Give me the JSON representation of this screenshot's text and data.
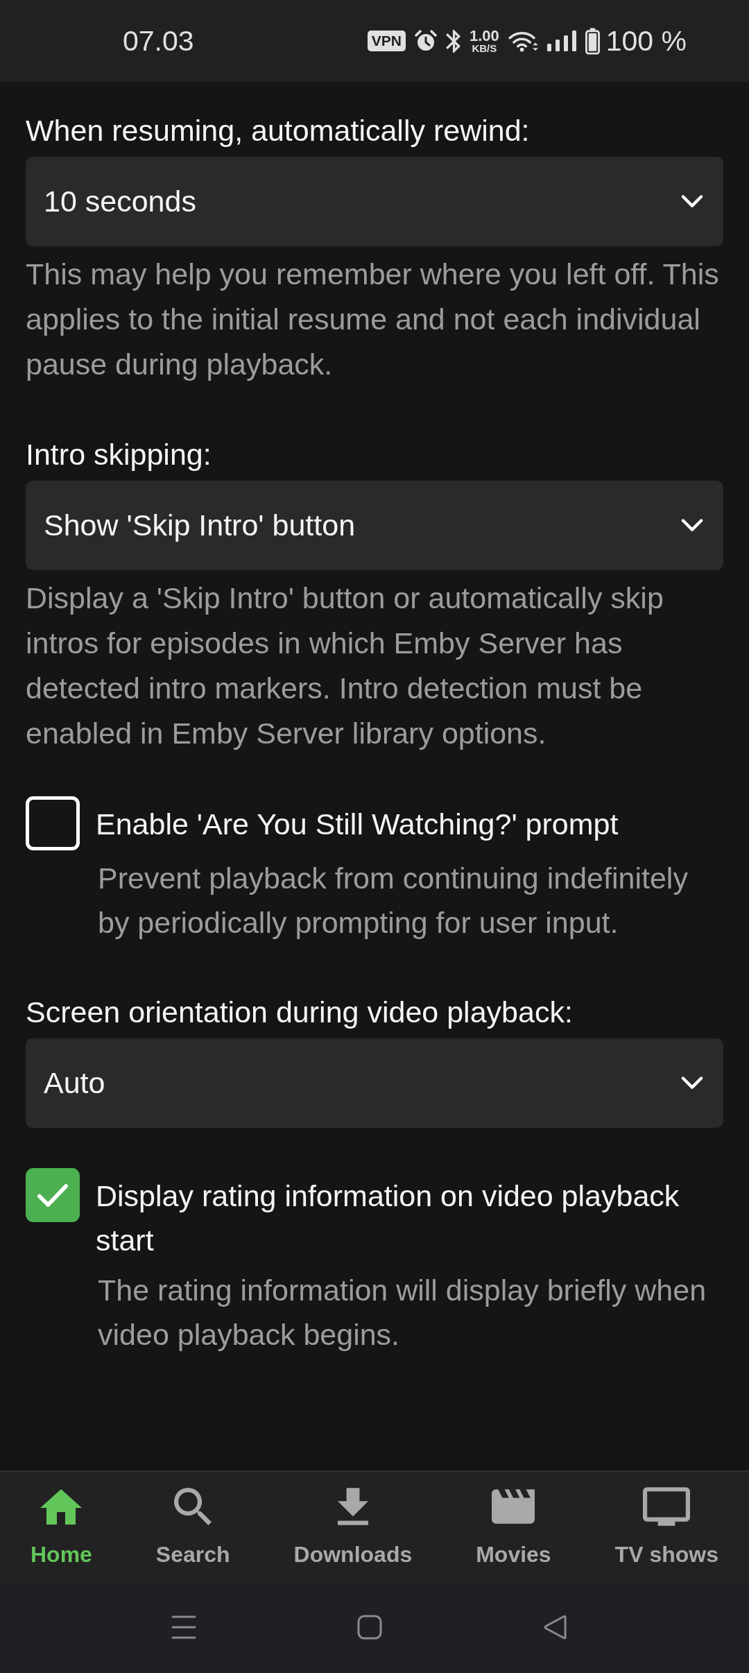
{
  "status_bar": {
    "time": "07.03",
    "vpn": "VPN",
    "network_speed": "1.00",
    "network_speed_unit": "KB/S",
    "battery": "100 %"
  },
  "settings": [
    {
      "kind": "dropdown",
      "label": "When resuming, automatically rewind:",
      "value": "10 seconds",
      "description": "This may help you remember where you left off. This applies to the initial resume and not each individual pause during playback."
    },
    {
      "kind": "dropdown",
      "label": "Intro skipping:",
      "value": "Show 'Skip Intro' button",
      "description": "Display a 'Skip Intro' button or automatically skip intros for episodes in which Emby Server has detected intro markers. Intro detection must be enabled in Emby Server library options."
    },
    {
      "kind": "checkbox",
      "label": "Enable 'Are You Still Watching?' prompt",
      "checked": false,
      "description": "Prevent playback from continuing indefinitely by periodically prompting for user input."
    },
    {
      "kind": "dropdown",
      "label": "Screen orientation during video playback:",
      "value": "Auto"
    },
    {
      "kind": "checkbox",
      "label": "Display rating information on video playback start",
      "checked": true,
      "description": "The rating information will display briefly when video playback begins."
    }
  ],
  "bottom_nav": [
    {
      "label": "Home",
      "selected": true
    },
    {
      "label": "Search",
      "selected": false
    },
    {
      "label": "Downloads",
      "selected": false
    },
    {
      "label": "Movies",
      "selected": false
    },
    {
      "label": "TV shows",
      "selected": false
    }
  ]
}
